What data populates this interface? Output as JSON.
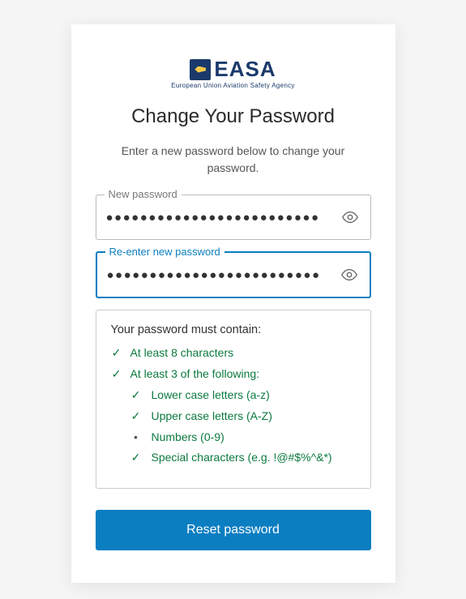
{
  "logo": {
    "text": "EASA",
    "subtitle": "European Union Aviation Safety Agency"
  },
  "title": "Change Your Password",
  "subtitle": "Enter a new password below to change your password.",
  "fields": {
    "new_password": {
      "label": "New password",
      "value": "●●●●●●●●●●●●●●●●●●●●●●●●●"
    },
    "reenter_password": {
      "label": "Re-enter new password",
      "value": "●●●●●●●●●●●●●●●●●●●●●●●●●"
    }
  },
  "rules": {
    "title": "Your password must contain:",
    "items": [
      {
        "mark": "✓",
        "text": "At least 8 characters",
        "met": true
      },
      {
        "mark": "✓",
        "text": "At least 3 of the following:",
        "met": true
      }
    ],
    "subitems": [
      {
        "mark": "✓",
        "text": "Lower case letters (a-z)",
        "met": true
      },
      {
        "mark": "✓",
        "text": "Upper case letters (A-Z)",
        "met": true
      },
      {
        "mark": "•",
        "text": "Numbers (0-9)",
        "met": false
      },
      {
        "mark": "✓",
        "text": "Special characters (e.g. !@#$%^&*)",
        "met": true
      }
    ]
  },
  "button": {
    "reset_label": "Reset password"
  },
  "colors": {
    "accent": "#0b7ec1",
    "success": "#0a7a3e",
    "brand": "#1b3a6b"
  }
}
